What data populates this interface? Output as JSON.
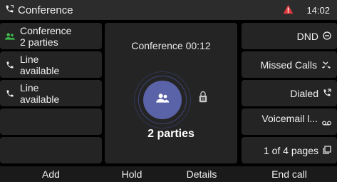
{
  "status_bar": {
    "title": "Conference",
    "time": "14:02"
  },
  "line_keys": [
    {
      "icon": "conference-icon",
      "line1": "Conference",
      "line2": "2 parties",
      "accent": "#3db54a"
    },
    {
      "icon": "phone-icon",
      "line1": "Line",
      "line2": "available"
    },
    {
      "icon": "phone-icon",
      "line1": "Line",
      "line2": "available"
    }
  ],
  "call": {
    "title": "Conference 00:12",
    "parties": "2 parties",
    "avatar_color": "#5a63a8"
  },
  "right_keys": {
    "dnd": "DND",
    "missed_calls": "Missed Calls",
    "dialed": "Dialed",
    "voicemail": "Voicemail l...",
    "pages": "1 of 4 pages"
  },
  "soft_keys": {
    "add": "Add",
    "hold": "Hold",
    "details": "Details",
    "end_call": "End call"
  },
  "colors": {
    "alert": "#e0393e",
    "background": "#000000",
    "key": "#242424"
  }
}
